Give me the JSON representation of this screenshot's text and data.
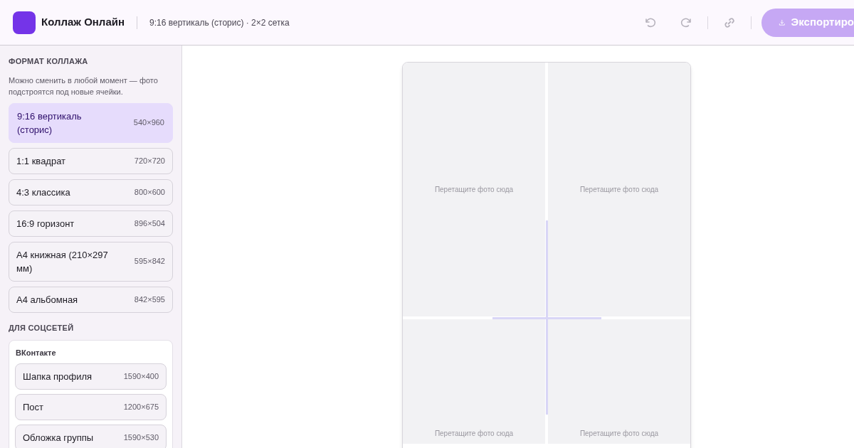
{
  "header": {
    "app_title": "Коллаж Онлайн",
    "subtitle": "9:16 вертикаль (сторис) · 2×2 сетка",
    "export_button": "Экспортиро"
  },
  "sidebar": {
    "format_heading": "ФОРМАТ КОЛЛАЖА",
    "format_hint": "Можно сменить в любой момент — фото подстроятся под новые ячейки.",
    "formats": [
      {
        "label": "9:16 вертикаль (сторис)",
        "size": "540×960",
        "selected": true
      },
      {
        "label": "1:1 квадрат",
        "size": "720×720",
        "selected": false
      },
      {
        "label": "4:3 классика",
        "size": "800×600",
        "selected": false
      },
      {
        "label": "16:9 горизонт",
        "size": "896×504",
        "selected": false
      },
      {
        "label": "A4 книжная (210×297 мм)",
        "size": "595×842",
        "selected": false
      },
      {
        "label": "A4 альбомная",
        "size": "842×595",
        "selected": false
      }
    ],
    "social_heading": "ДЛЯ СОЦСЕТЕЙ",
    "social_groups": [
      {
        "name": "ВКонтакте",
        "items": [
          {
            "label": "Шапка профиля",
            "size": "1590×400",
            "selected": false
          },
          {
            "label": "Пост",
            "size": "1200×675",
            "selected": false
          },
          {
            "label": "Обложка группы",
            "size": "1590×530",
            "selected": false
          }
        ]
      }
    ]
  },
  "canvas": {
    "cells": [
      {
        "placeholder": "Перетащите фото сюда"
      },
      {
        "placeholder": "Перетащите фото сюда"
      },
      {
        "placeholder": "Перетащите фото сюда"
      },
      {
        "placeholder": "Перетащите фото сюда"
      }
    ]
  }
}
